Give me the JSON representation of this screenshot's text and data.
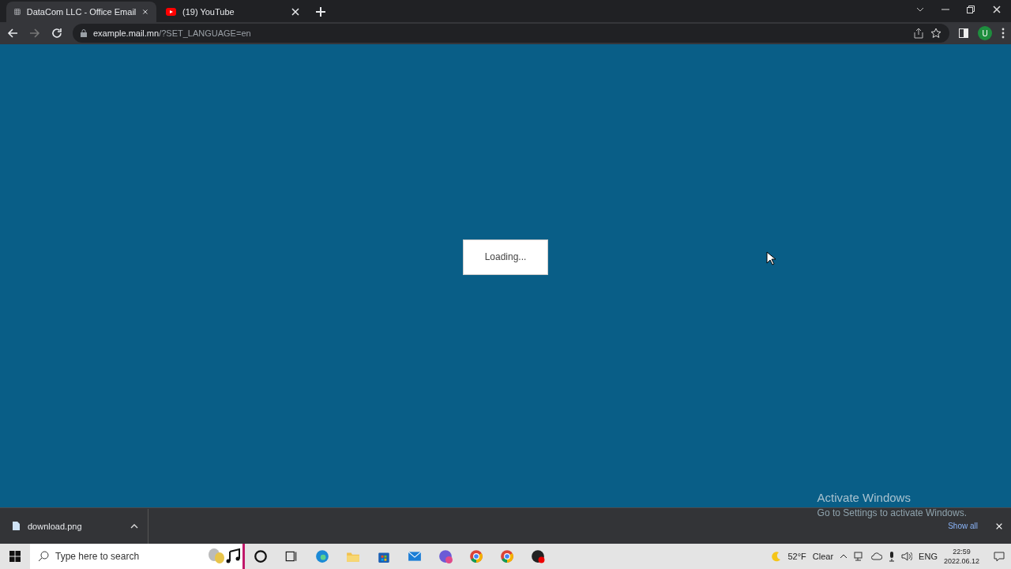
{
  "browser": {
    "tabs": [
      {
        "title": "DataCom LLC - Office Email",
        "selected": true,
        "kind": "grid"
      },
      {
        "title": "(19) YouTube",
        "selected": false,
        "kind": "video"
      }
    ],
    "address": {
      "host": "example.mail.mn",
      "path": "/?SET_LANGUAGE=en"
    },
    "profile": "U"
  },
  "page": {
    "loading": "Loading..."
  },
  "watermark": {
    "title": "Activate Windows",
    "subtitle": "Go to Settings to activate Windows."
  },
  "downloads": {
    "file": "download.png",
    "show_all": "Show all"
  },
  "taskbar": {
    "search_placeholder": "Type here to search",
    "weather": "52°F",
    "condition": "Clear",
    "language": "ENG",
    "time": "22:59",
    "date": "2022.06.12"
  }
}
